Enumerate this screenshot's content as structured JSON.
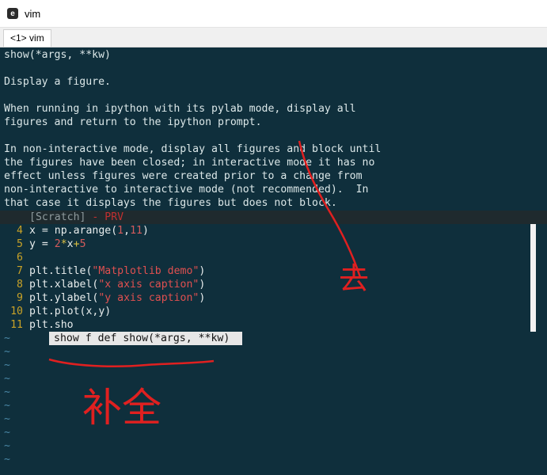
{
  "window": {
    "title": "vim",
    "app_icon": "vim-app-icon"
  },
  "tabs": [
    {
      "label": "<1> vim"
    }
  ],
  "help": {
    "lines": [
      "show(*args, **kw)",
      "",
      "Display a figure.",
      "",
      "When running in ipython with its pylab mode, display all",
      "figures and return to the ipython prompt.",
      "",
      "In non-interactive mode, display all figures and block until",
      "the figures have been closed; in interactive mode it has no",
      "effect unless figures were created prior to a change from",
      "non-interactive to interactive mode (not recommended).  In",
      "that case it displays the figures but does not block."
    ]
  },
  "statusline": {
    "buffer": "[Scratch]",
    "sep": " - ",
    "flag": "PRV"
  },
  "editor": {
    "lines": [
      {
        "num": "4",
        "code": "x = np.arange(1,11)"
      },
      {
        "num": "5",
        "code": "y = 2*x+5"
      },
      {
        "num": "6",
        "code": ""
      },
      {
        "num": "7",
        "code": "plt.title(\"Matplotlib demo\")"
      },
      {
        "num": "8",
        "code": "plt.xlabel(\"x axis caption\")"
      },
      {
        "num": "9",
        "code": "plt.ylabel(\"y axis caption\")"
      },
      {
        "num": "10",
        "code": "plt.plot(x,y)"
      },
      {
        "num": "11",
        "code": "plt.sho"
      }
    ],
    "tilde_count": 10
  },
  "completion_popup": {
    "item": "show f def show(*args, **kw)"
  },
  "annotations": {
    "label_top": "去",
    "label_bottom": "补全",
    "color": "#e02020"
  },
  "colors": {
    "background": "#0f2f3c",
    "line_number": "#c9a227",
    "string": "#e05050",
    "tilde": "#4a87a6",
    "status_flag": "#c23030"
  }
}
